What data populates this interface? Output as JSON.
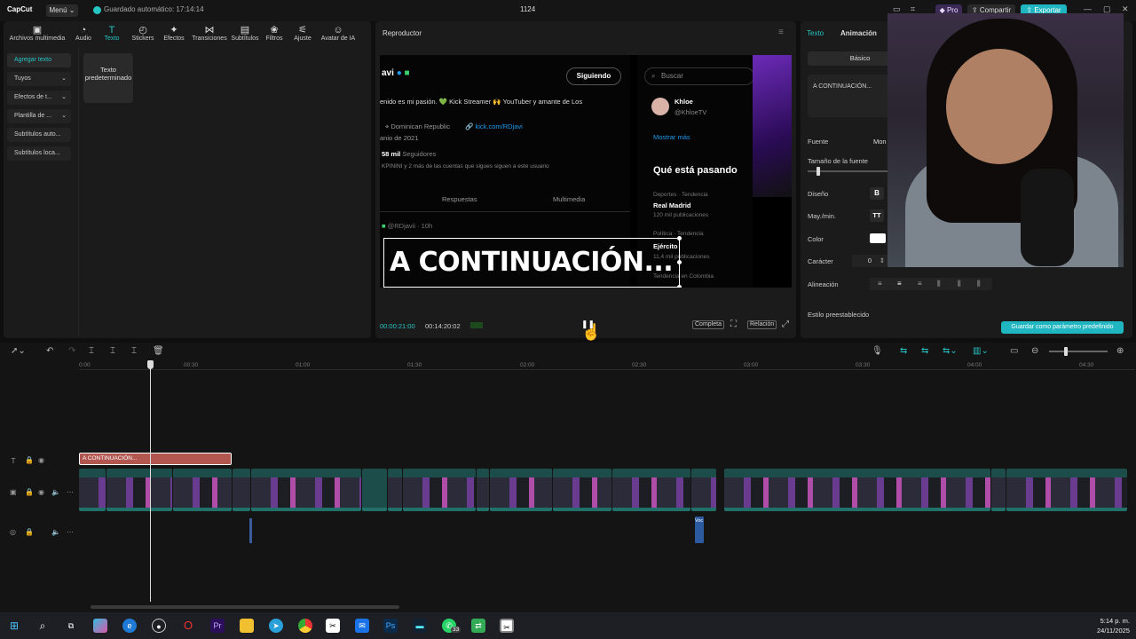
{
  "app": {
    "logo": "CapCut",
    "menu_label": "Menú",
    "autosave": "Guardado automático: 17:14:14",
    "project_name": "1124",
    "pro_label": "Pro",
    "share_label": "Compartir",
    "export_label": "Exportar",
    "accent_color": "#27c4c4"
  },
  "toolbar": {
    "items": [
      {
        "label": "Archivos multimedia",
        "icon": "media-icon"
      },
      {
        "label": "Audio",
        "icon": "audio-icon"
      },
      {
        "label": "Texto",
        "icon": "text-icon"
      },
      {
        "label": "Stickers",
        "icon": "stickers-icon"
      },
      {
        "label": "Efectos",
        "icon": "effects-icon"
      },
      {
        "label": "Transiciones",
        "icon": "transitions-icon"
      },
      {
        "label": "Subtítulos",
        "icon": "subtitles-icon"
      },
      {
        "label": "Filtros",
        "icon": "filters-icon"
      },
      {
        "label": "Ajuste",
        "icon": "adjust-icon"
      },
      {
        "label": "Avatar de IA",
        "icon": "ai-avatar-icon"
      }
    ]
  },
  "sidebar": {
    "items": [
      {
        "label": "Agregar texto"
      },
      {
        "label": "Tuyos"
      },
      {
        "label": "Efectos de t..."
      },
      {
        "label": "Plantilla de ..."
      },
      {
        "label": "Subtítulos auto..."
      },
      {
        "label": "Subtítulos loca..."
      }
    ],
    "card_label": "Texto predeterminado"
  },
  "player": {
    "title": "Reproductor",
    "current_time": "00:00:21:00",
    "total_time": "00:14:20:02",
    "complete_label": "Completa",
    "ratio_label": "Relación",
    "preview": {
      "profile_name": "avi",
      "bio": "enido es mi pasión. 💚 Kick Streamer 🙌 YouTuber y amante de Los",
      "location": "Dominican Republic",
      "link": "kick.com/RDjavi",
      "joined": "anio de 2021",
      "followers": "58 mil",
      "followers_label": "Seguidores",
      "followed_by": "KPININI y 2 más de las cuentas que sigues siguen a este usuario",
      "follow_btn": "Siguiendo",
      "tab_replies": "Respuestas",
      "tab_media": "Multimedia",
      "handle": "@RDjavii · 10h",
      "search_placeholder": "Buscar",
      "suggest_name": "Khloe",
      "suggest_handle": "@KhloeTV",
      "show_more": "Mostrar más",
      "trending_title": "Qué está pasando",
      "trend1_cat": "Deportes · Tendencia",
      "trend1_name": "Real Madrid",
      "trend1_count": "120 mil publicaciones",
      "trend2_cat": "Política · Tendencia",
      "trend2_name": "Ejército",
      "trend2_count": "11,4 mil publicaciones",
      "trend3_cat": "Tendencia en Colombia",
      "overlay_text": "A CONTINUACIÓN..."
    }
  },
  "props": {
    "tab_text": "Texto",
    "tab_animation": "Animación",
    "basic_tab": "Básico",
    "text_value": "A CONTINUACIÓN...",
    "font_label": "Fuente",
    "font_value": "Mon",
    "size_label": "Tamaño de la fuente",
    "design_label": "Diseño",
    "bold_label": "B",
    "case_label": "May./min.",
    "case_value": "TT",
    "color_label": "Color",
    "char_label": "Carácter",
    "char_value": "0",
    "align_label": "Alineación",
    "preset_label": "Estilo preestablecido",
    "save_preset": "Guardar como parámetro predefinido"
  },
  "timeline": {
    "ruler": [
      "0:00",
      "00:30",
      "01:00",
      "01:30",
      "02:00",
      "02:30",
      "03:00",
      "03:30",
      "04:00",
      "04:30"
    ],
    "text_clip": "A CONTINUACIÓN...",
    "clip_labels": [
      "2025-11-24",
      "2025-11-24 16-17-42.m",
      "2025-11-24 16-17-42",
      "INTR",
      "2025-11-24 16-17-42.mkv",
      "00:00:30:02",
      "202",
      "2025-11-24 16-17-42.mkv",
      "00",
      "2025-11-24 16-17-42.m",
      "2025-11-24 16-17-42",
      "2025-11-24 16-17-42.mkv",
      "20",
      "2025-11-24 16-17-42.mkv",
      "00:00:34:21",
      "20",
      "2025-11-24 16-17-42.mkv"
    ],
    "voice_label": "Voc"
  },
  "taskbar": {
    "time": "5:14 p. m.",
    "date": "24/11/2025",
    "badge": "33"
  }
}
